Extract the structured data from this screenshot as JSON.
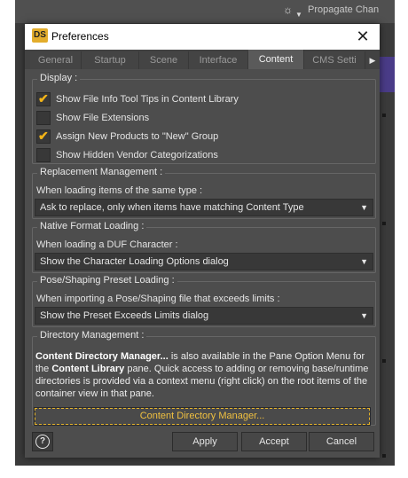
{
  "window": {
    "title": "Preferences",
    "logo": "DS",
    "close_glyph": "✕"
  },
  "background": {
    "snippet": "Propagate Chan"
  },
  "tabs": [
    {
      "label": "General"
    },
    {
      "label": "Startup"
    },
    {
      "label": "Scene"
    },
    {
      "label": "Interface"
    },
    {
      "label": "Content"
    },
    {
      "label": "CMS Setti"
    }
  ],
  "active_tab": "Content",
  "tab_scroll_glyph": "▶",
  "display": {
    "title": "Display :",
    "options": [
      {
        "label": "Show File Info Tool Tips in Content Library",
        "checked": true
      },
      {
        "label": "Show File Extensions",
        "checked": false
      },
      {
        "label": "Assign New Products to \"New\" Group",
        "checked": true
      },
      {
        "label": "Show Hidden Vendor Categorizations",
        "checked": false
      }
    ],
    "check_glyph": "✔"
  },
  "replacement": {
    "title": "Replacement Management :",
    "prompt": "When loading items of the same type :",
    "selected": "Ask to replace, only when items have matching Content Type"
  },
  "native_format": {
    "title": "Native Format Loading :",
    "prompt": "When loading a DUF Character :",
    "selected": "Show the Character Loading Options dialog"
  },
  "pose_shaping": {
    "title": "Pose/Shaping Preset Loading :",
    "prompt": "When importing a Pose/Shaping file that exceeds limits :",
    "selected": "Show the Preset Exceeds Limits dialog"
  },
  "directory": {
    "title": "Directory Management :",
    "text_bold_1": "Content Directory Manager...",
    "text_1": " is also available in the Pane Option Menu for the ",
    "text_bold_2": "Content Library",
    "text_2": " pane. Quick access to adding or removing base/runtime directories is provided via a context menu (right click) on the root items of the container view in that pane.",
    "button_label": "Content Directory Manager..."
  },
  "dropdown_glyph": "▼",
  "footer": {
    "help_glyph": "?",
    "apply": "Apply",
    "accept": "Accept",
    "cancel": "Cancel"
  },
  "colors": {
    "accent": "#f2b418",
    "dialog_bg": "#4d4d4d",
    "titlebar_bg": "#ffffff"
  }
}
